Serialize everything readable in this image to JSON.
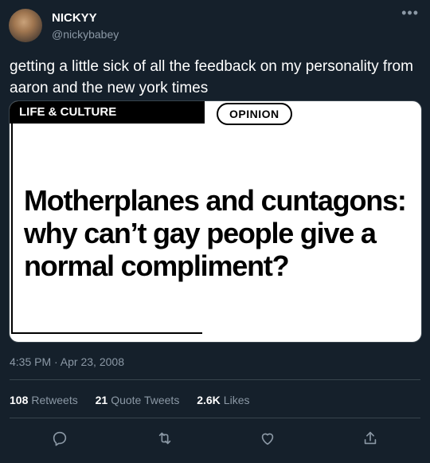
{
  "author": {
    "name": "NICKYY",
    "handle": "@nickybabey"
  },
  "more_icon": "more-horizontal-icon",
  "tweet": {
    "text": "getting a little sick of all the feedback on my personality from aaron and the new york times",
    "timestamp": "4:35 PM · Apr 23, 2008"
  },
  "media": {
    "section_tag": "LIFE & CULTURE",
    "opinion_tag": "OPINION",
    "headline": "Motherplanes and cuntagons: why can’t gay people give a normal compliment?"
  },
  "stats": {
    "retweets": {
      "count": "108",
      "label": "Retweets"
    },
    "quotes": {
      "count": "21",
      "label": "Quote Tweets"
    },
    "likes": {
      "count": "2.6K",
      "label": "Likes"
    }
  },
  "actions": [
    {
      "icon": "reply-icon"
    },
    {
      "icon": "retweet-icon"
    },
    {
      "icon": "like-icon"
    },
    {
      "icon": "share-icon"
    }
  ],
  "colors": {
    "background": "#15202b",
    "secondary_text": "#8b98a5",
    "divider": "#38444d"
  }
}
